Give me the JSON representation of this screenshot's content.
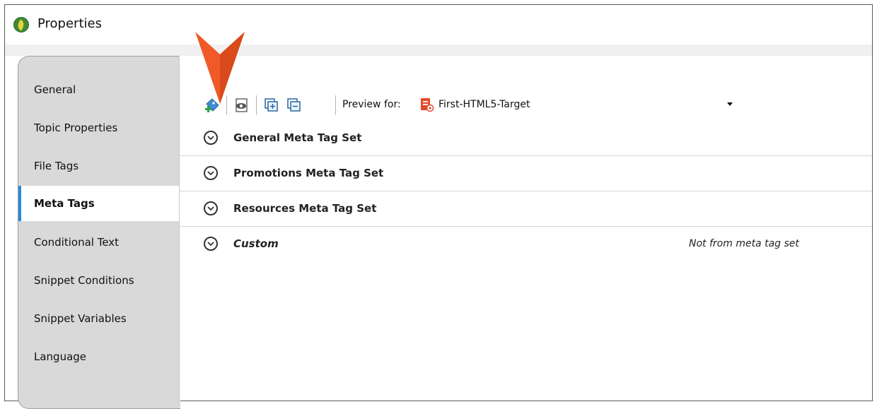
{
  "window": {
    "title": "Properties"
  },
  "sidebar": {
    "items": [
      {
        "label": "General",
        "active": false
      },
      {
        "label": "Topic Properties",
        "active": false
      },
      {
        "label": "File Tags",
        "active": false
      },
      {
        "label": "Meta Tags",
        "active": true
      },
      {
        "label": "Conditional Text",
        "active": false
      },
      {
        "label": "Snippet Conditions",
        "active": false
      },
      {
        "label": "Snippet Variables",
        "active": false
      },
      {
        "label": "Language",
        "active": false
      }
    ]
  },
  "toolbar": {
    "preview_label": "Preview for:",
    "preview_target": "First-HTML5-Target",
    "icons": [
      "add-meta-tag-icon",
      "preview-eye-icon",
      "expand-all-icon",
      "collapse-all-icon",
      "html5-target-icon",
      "dropdown-arrow-icon"
    ]
  },
  "meta_sets": [
    {
      "label": "General Meta Tag Set",
      "italic": false,
      "note": ""
    },
    {
      "label": "Promotions Meta Tag Set",
      "italic": false,
      "note": ""
    },
    {
      "label": "Resources Meta Tag Set",
      "italic": false,
      "note": ""
    },
    {
      "label": "Custom",
      "italic": true,
      "note": "Not from meta tag set"
    }
  ],
  "colors": {
    "accent": "#2a8ad8",
    "pointer": "#f05a28",
    "sidebar_bg": "#d9d9d9"
  }
}
